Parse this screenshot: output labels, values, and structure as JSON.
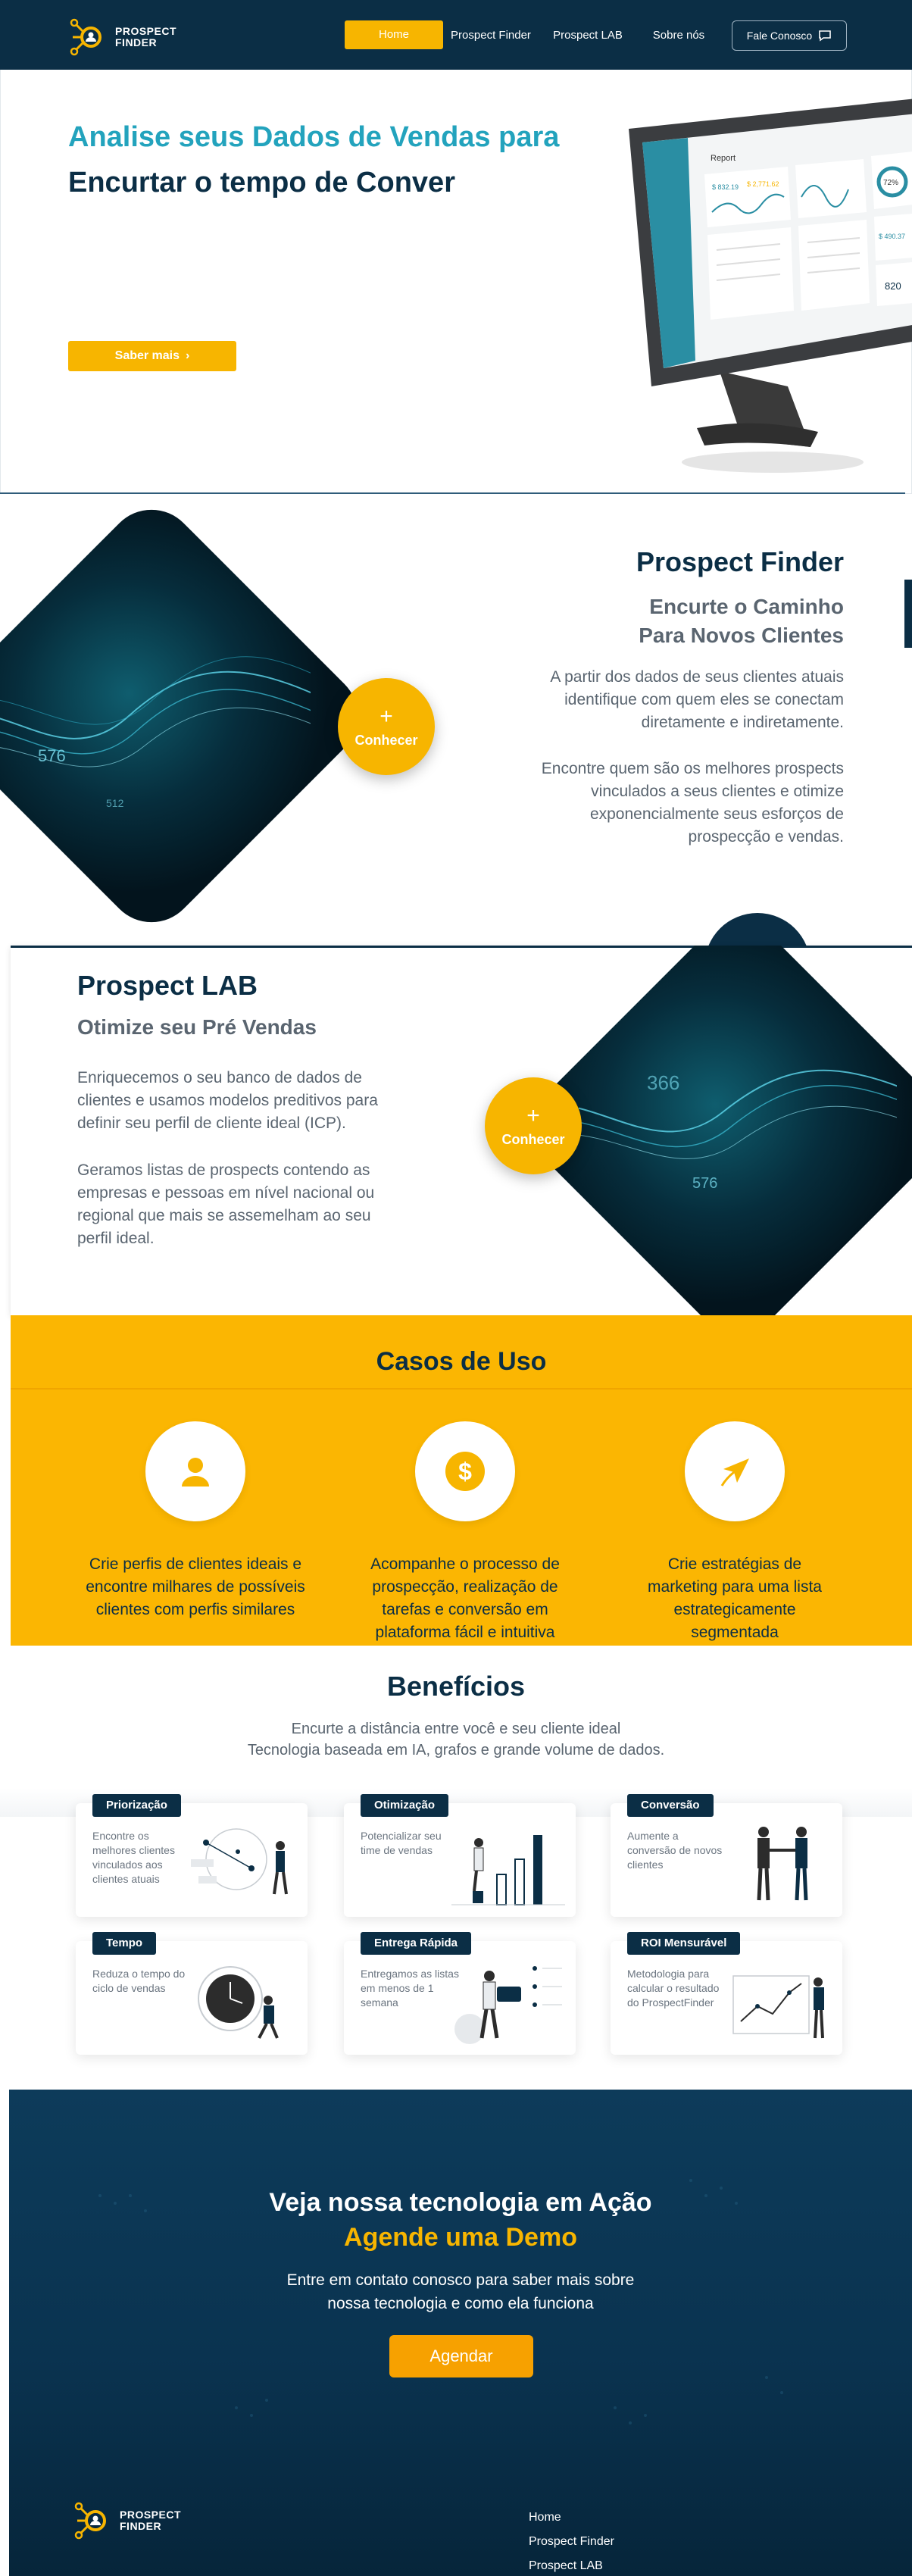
{
  "nav": {
    "logo_line1": "PROSPECT",
    "logo_line2": "FINDER",
    "items": [
      "Home",
      "Prospect Finder",
      "Prospect LAB",
      "Sobre nós"
    ],
    "cta": "Fale Conosco"
  },
  "hero": {
    "title_line1": "Analise seus Dados de Vendas para",
    "title_line2": "Encurtar o tempo de Conver",
    "button": "Saber mais",
    "report": {
      "title": "Report",
      "val1": "$ 832.19",
      "val2": "$ 2,771.62",
      "percent": "72%",
      "val3": "$ 490.37",
      "count": "820"
    }
  },
  "finder": {
    "title": "Prospect Finder",
    "subtitle_line1": "Encurte o Caminho",
    "subtitle_line2": "Para Novos Clientes",
    "p1": [
      "A partir dos dados de seus clientes atuais",
      "identifique com quem eles se conectam",
      "diretamente e indiretamente."
    ],
    "p2": [
      "Encontre quem são os melhores prospects",
      "vinculados a seus clientes e otimize",
      "exponencialmente seus esforços de",
      "prospecção e vendas."
    ],
    "button": "Conhecer",
    "diamond_numbers": [
      "576",
      "512"
    ]
  },
  "lab": {
    "title": "Prospect LAB",
    "subtitle": "Otimize seu Pré Vendas",
    "p1": [
      "Enriquecemos o seu banco de dados de",
      "clientes e usamos modelos preditivos para",
      "definir seu perfil de cliente ideal (ICP)."
    ],
    "p2": [
      "Geramos listas de prospects contendo as",
      "empresas e pessoas em nível nacional ou",
      "regional que mais se assemelham ao seu",
      "perfil ideal."
    ],
    "button": "Conhecer",
    "diamond_numbers": [
      "366",
      "576"
    ]
  },
  "casos": {
    "title": "Casos de Uso",
    "items": [
      {
        "icon": "user-icon",
        "lines": [
          "Crie perfis de clientes ideais e",
          "encontre milhares de possíveis",
          "clientes com perfis similares"
        ]
      },
      {
        "icon": "dollar-icon",
        "lines": [
          "Acompanhe o processo de",
          "prospecção, realização de",
          "tarefas e conversão em",
          "plataforma fácil e intuitiva"
        ]
      },
      {
        "icon": "send-icon",
        "lines": [
          "Crie estratégias de",
          "marketing para uma lista",
          "estrategicamente",
          "segmentada"
        ]
      }
    ]
  },
  "beneficios": {
    "title": "Benefícios",
    "sub_line1": "Encurte a distância entre você e seu cliente ideal",
    "sub_line2": "Tecnologia baseada em IA, grafos e grande volume de dados.",
    "cards": [
      {
        "tag": "Priorização",
        "text": "Encontre os melhores clientes vinculados aos clientes atuais"
      },
      {
        "tag": "Otimização",
        "text": "Potencializar seu time de vendas"
      },
      {
        "tag": "Conversão",
        "text": "Aumente a conversão de novos clientes"
      },
      {
        "tag": "Tempo",
        "text": "Reduza o tempo do ciclo de vendas"
      },
      {
        "tag": "Entrega Rápida",
        "text": "Entregamos as listas em menos de 1 semana"
      },
      {
        "tag": "ROI Mensurável",
        "text": "Metodologia para calcular o resultado do ProspectFinder"
      }
    ]
  },
  "demo": {
    "title": "Veja nossa tecnologia em Ação",
    "subtitle": "Agende uma Demo",
    "p_line1": "Entre em contato conosco para saber mais sobre",
    "p_line2": "nossa tecnologia e como ela funciona",
    "button": "Agendar"
  },
  "footer": {
    "links": [
      "Home",
      "Prospect Finder",
      "Prospect LAB"
    ]
  },
  "colors": {
    "navy": "#0b2e45",
    "accent": "#f7b500",
    "teal": "#23a3bd"
  }
}
